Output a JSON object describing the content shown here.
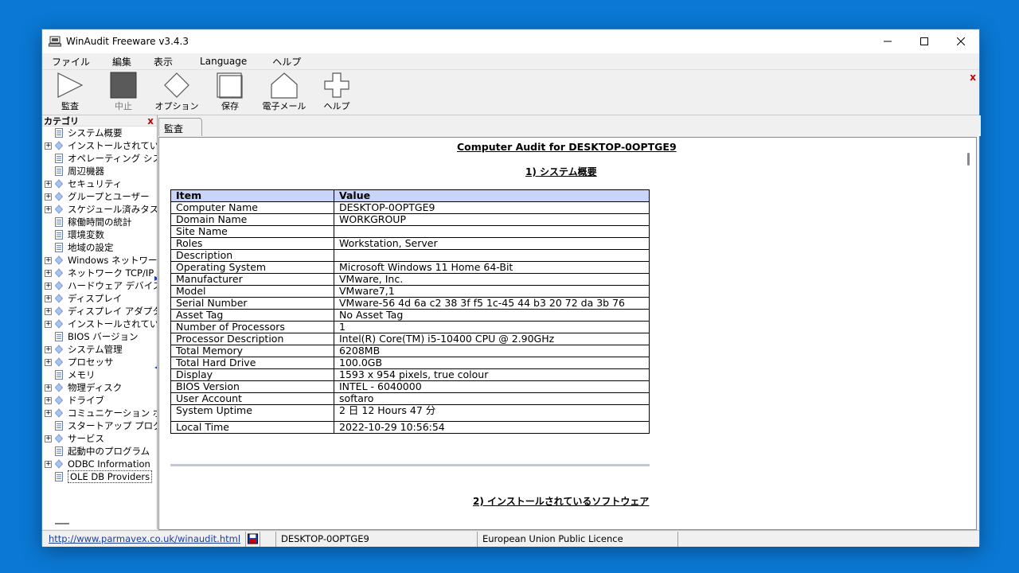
{
  "window": {
    "title": "WinAudit Freeware v3.4.3"
  },
  "menu": [
    "ファイル",
    "編集",
    "表示",
    "Language",
    "ヘルプ"
  ],
  "toolbar": {
    "audit": "監査",
    "stop": "中止",
    "options": "オプション",
    "save": "保存",
    "email": "電子メール",
    "help": "ヘルプ",
    "close": "x"
  },
  "sidebar": {
    "title": "カテゴリ",
    "close": "x",
    "items": [
      {
        "label": "システム概要",
        "type": "doc",
        "expand": false
      },
      {
        "label": "インストールされているソフトウェア",
        "type": "diamond",
        "expand": true
      },
      {
        "label": "オペレーティング システム",
        "type": "doc",
        "expand": false
      },
      {
        "label": "周辺機器",
        "type": "doc",
        "expand": false
      },
      {
        "label": "セキュリティ",
        "type": "diamond",
        "expand": true
      },
      {
        "label": "グループとユーザー",
        "type": "diamond",
        "expand": true
      },
      {
        "label": "スケジュール済みタスク",
        "type": "diamond",
        "expand": true
      },
      {
        "label": "稼働時間の統計",
        "type": "doc",
        "expand": false
      },
      {
        "label": "環境変数",
        "type": "doc",
        "expand": false
      },
      {
        "label": "地域の設定",
        "type": "doc",
        "expand": false
      },
      {
        "label": "Windows ネットワーク",
        "type": "diamond",
        "expand": true
      },
      {
        "label": "ネットワーク TCP/IP",
        "type": "diamond",
        "expand": true
      },
      {
        "label": "ハードウェア デバイス",
        "type": "diamond",
        "expand": true
      },
      {
        "label": "ディスプレイ",
        "type": "diamond",
        "expand": true
      },
      {
        "label": "ディスプレイ アダプタ",
        "type": "diamond",
        "expand": true
      },
      {
        "label": "インストールされているプリンタ",
        "type": "diamond",
        "expand": true
      },
      {
        "label": "BIOS バージョン",
        "type": "doc",
        "expand": false
      },
      {
        "label": "システム管理",
        "type": "diamond",
        "expand": true
      },
      {
        "label": "プロセッサ",
        "type": "diamond",
        "expand": true
      },
      {
        "label": "メモリ",
        "type": "doc",
        "expand": false
      },
      {
        "label": "物理ディスク",
        "type": "diamond",
        "expand": true
      },
      {
        "label": "ドライブ",
        "type": "diamond",
        "expand": true
      },
      {
        "label": "コミュニケーション ポート",
        "type": "diamond",
        "expand": true
      },
      {
        "label": "スタートアップ プログラム",
        "type": "doc",
        "expand": false
      },
      {
        "label": "サービス",
        "type": "diamond",
        "expand": true
      },
      {
        "label": "起動中のプログラム",
        "type": "doc",
        "expand": false
      },
      {
        "label": "ODBC Information",
        "type": "diamond",
        "expand": true
      },
      {
        "label": "OLE DB Providers",
        "type": "doc",
        "expand": false,
        "selected": true
      }
    ]
  },
  "tab": {
    "label": "監査"
  },
  "report": {
    "title": "Computer Audit for DESKTOP-0OPTGE9",
    "section1": "1) システム概要",
    "section2": "2) インストールされているソフトウェア",
    "headers": [
      "Item",
      "Value"
    ],
    "rows": [
      [
        "Computer Name",
        "DESKTOP-0OPTGE9"
      ],
      [
        "Domain Name",
        "WORKGROUP"
      ],
      [
        "Site Name",
        ""
      ],
      [
        "Roles",
        "Workstation, Server"
      ],
      [
        "Description",
        ""
      ],
      [
        "Operating System",
        "Microsoft Windows 11 Home 64-Bit"
      ],
      [
        "Manufacturer",
        "VMware, Inc."
      ],
      [
        "Model",
        "VMware7,1"
      ],
      [
        "Serial Number",
        "VMware-56 4d 6a c2 38 3f f5 1c-45 44 b3 20 72 da 3b 76"
      ],
      [
        "Asset Tag",
        "No Asset Tag"
      ],
      [
        "Number of Processors",
        "1"
      ],
      [
        "Processor Description",
        "Intel(R) Core(TM) i5-10400 CPU @ 2.90GHz"
      ],
      [
        "Total Memory",
        "6208MB"
      ],
      [
        "Total Hard Drive",
        "100.0GB"
      ],
      [
        "Display",
        "1593 x 954 pixels, true colour"
      ],
      [
        "BIOS Version",
        "INTEL  - 6040000"
      ],
      [
        "User Account",
        "softaro"
      ],
      [
        "System Uptime",
        "2 日 12 Hours 47 分"
      ],
      [
        "Local Time",
        "2022-10-29 10:56:54"
      ]
    ]
  },
  "status": {
    "url": "http://www.parmavex.co.uk/winaudit.html",
    "computer": "DESKTOP-0OPTGE9",
    "license": "European Union Public Licence"
  }
}
